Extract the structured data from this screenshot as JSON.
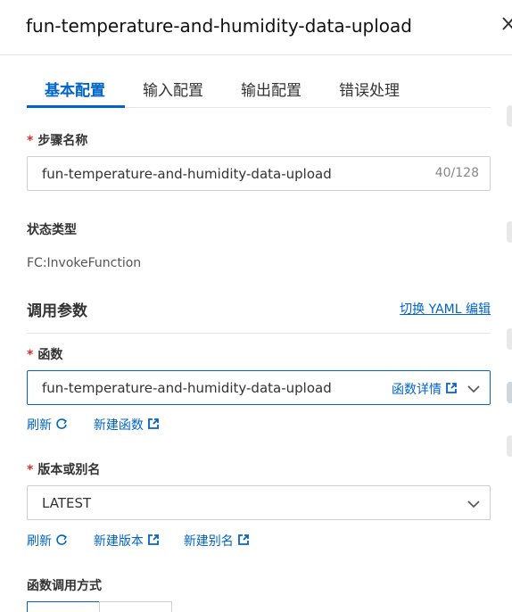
{
  "header": {
    "title": "fun-temperature-and-humidity-data-upload",
    "close_glyph": "✕"
  },
  "tabs": [
    {
      "label": "基本配置",
      "active": true
    },
    {
      "label": "输入配置",
      "active": false
    },
    {
      "label": "输出配置",
      "active": false
    },
    {
      "label": "错误处理",
      "active": false
    }
  ],
  "step_name": {
    "required_mark": "*",
    "label": "步骤名称",
    "value": "fun-temperature-and-humidity-data-upload",
    "counter": "40/128"
  },
  "state_type": {
    "label": "状态类型",
    "value": "FC:InvokeFunction"
  },
  "params": {
    "title": "调用参数",
    "yaml_link": "切换 YAML 编辑"
  },
  "function": {
    "required_mark": "*",
    "label": "函数",
    "value": "fun-temperature-and-humidity-data-upload",
    "detail_link": "函数详情",
    "refresh": "刷新",
    "create": "新建函数"
  },
  "version": {
    "required_mark": "*",
    "label": "版本或别名",
    "value": "LATEST",
    "refresh": "刷新",
    "create_version": "新建版本",
    "create_alias": "新建别名"
  },
  "invoke_mode": {
    "label": "函数调用方式"
  },
  "colors": {
    "accent": "#0064c8",
    "required": "#d93026"
  }
}
